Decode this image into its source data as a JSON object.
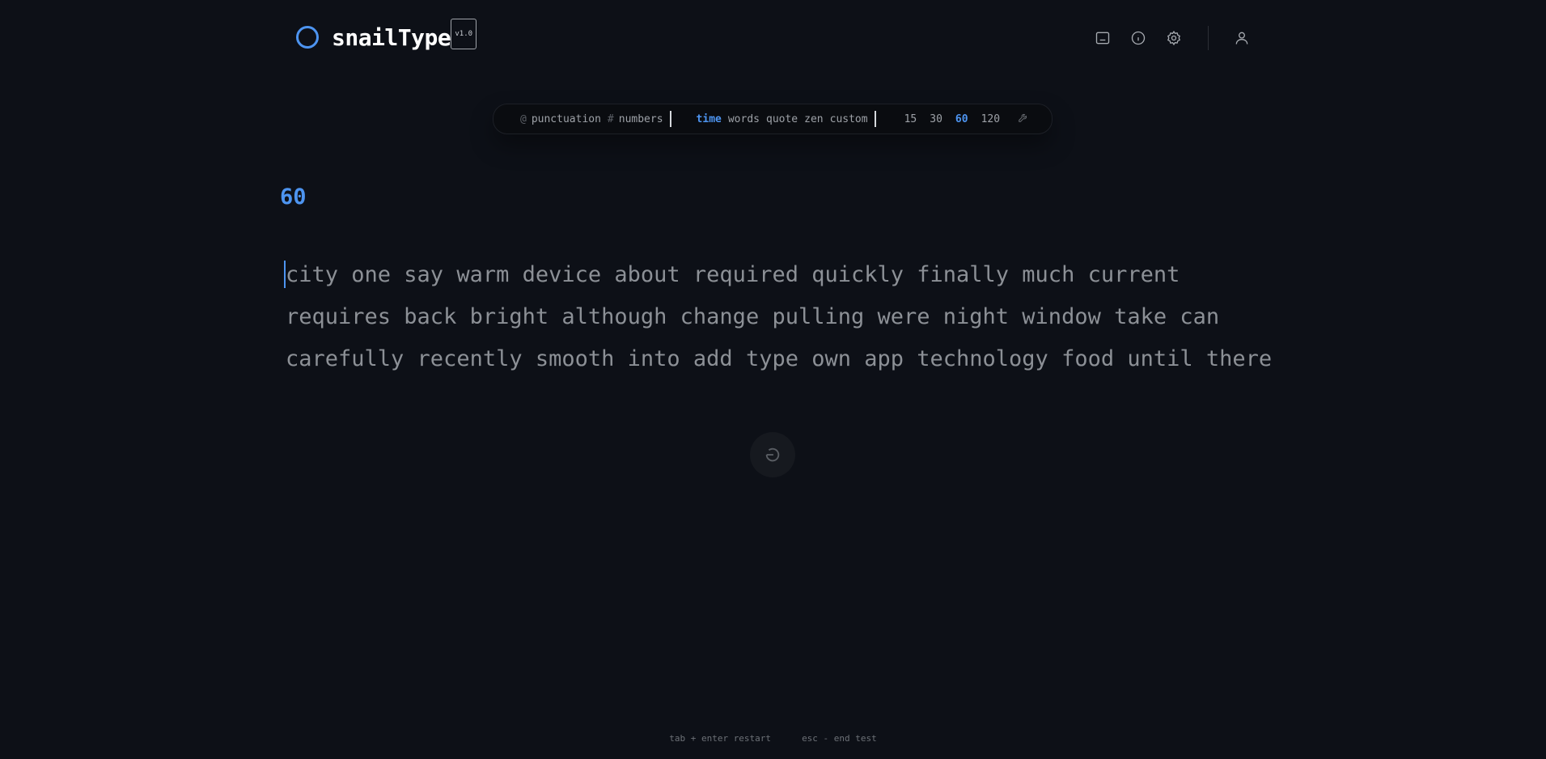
{
  "header": {
    "logo_text": "snailType",
    "version": "v1.0",
    "icons": [
      "keyboard-icon",
      "info-icon",
      "settings-icon",
      "user-icon"
    ]
  },
  "config": {
    "punctuation": {
      "symbol": "@",
      "label": "punctuation"
    },
    "numbers": {
      "symbol": "#",
      "label": "numbers"
    },
    "modes": [
      "time",
      "words",
      "quote",
      "zen",
      "custom"
    ],
    "active_mode": "time",
    "durations": [
      "15",
      "30",
      "60",
      "120"
    ],
    "active_duration": "60"
  },
  "timer": "60",
  "words": {
    "line1": "city one say warm device about required quickly finally much current",
    "line2": "requires back bright although change pulling were night window take can",
    "line3": "carefully recently smooth into add type own app technology food until there"
  },
  "hints": {
    "restart": "tab + enter restart",
    "end": "esc - end test"
  },
  "colors": {
    "accent": "#4d94f0",
    "background": "#0d1017",
    "text": "#8c9096"
  }
}
